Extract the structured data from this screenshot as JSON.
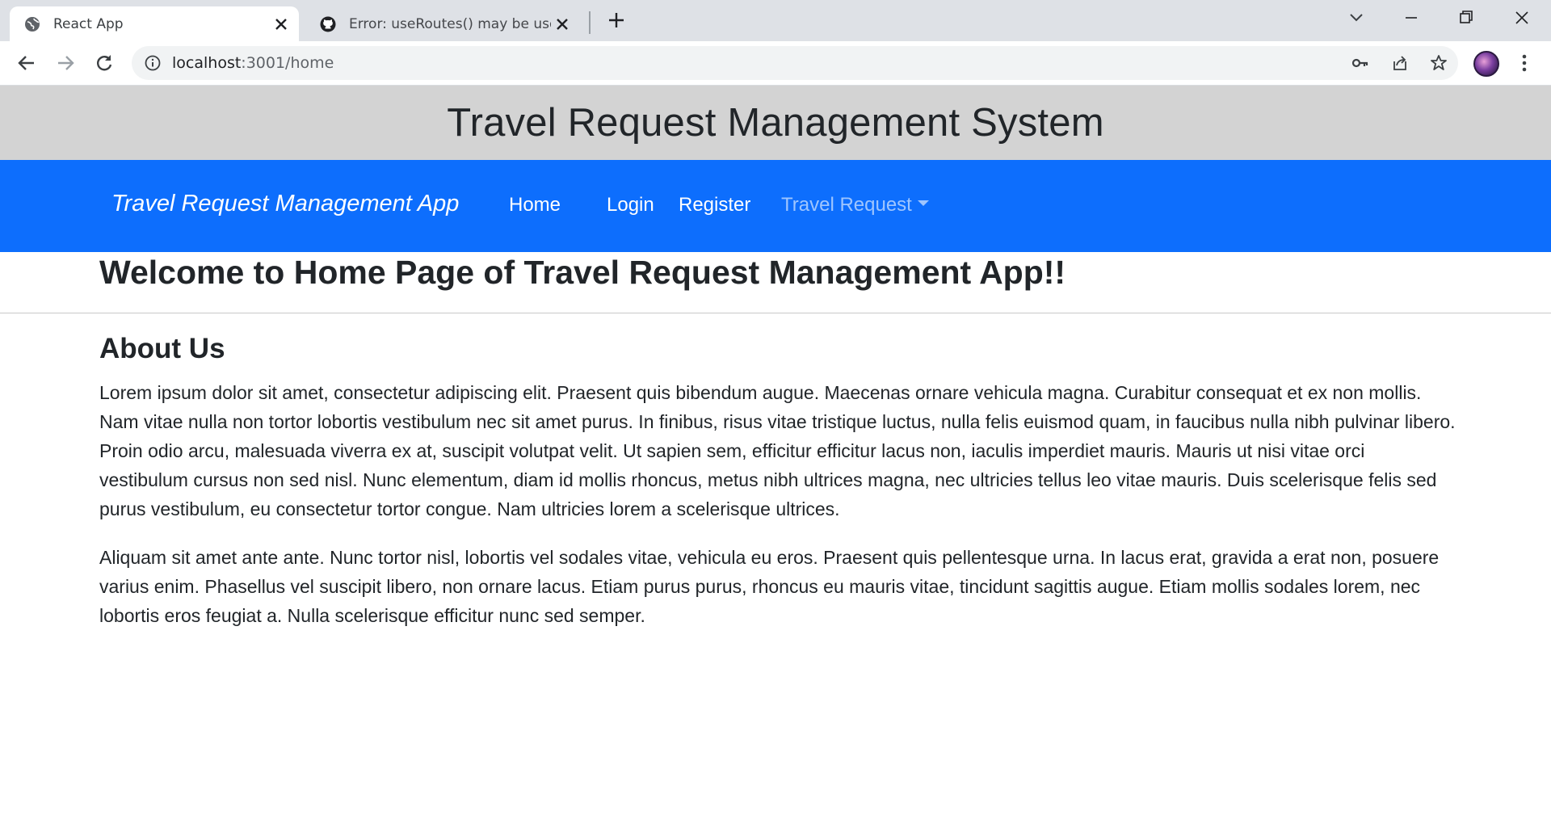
{
  "browser": {
    "tabs": [
      {
        "title": "React App",
        "icon": "globe-icon",
        "active": true
      },
      {
        "title": "Error: useRoutes() may be used only in the context",
        "icon": "github-icon",
        "active": false
      }
    ],
    "url_host": "localhost",
    "url_path": ":3001/home"
  },
  "site": {
    "header_title": "Travel Request Management System"
  },
  "navbar": {
    "brand": "Travel Request Management App",
    "links": [
      "Home",
      "Login",
      "Register"
    ],
    "dropdown": "Travel Request",
    "color": "#0d6efd"
  },
  "main": {
    "welcome": "Welcome to Home Page of Travel Request Management App!!",
    "about_title": "About Us",
    "paragraphs": [
      "Lorem ipsum dolor sit amet, consectetur adipiscing elit. Praesent quis bibendum augue. Maecenas ornare vehicula magna. Curabitur consequat et ex non mollis. Nam vitae nulla non tortor lobortis vestibulum nec sit amet purus. In finibus, risus vitae tristique luctus, nulla felis euismod quam, in faucibus nulla nibh pulvinar libero. Proin odio arcu, malesuada viverra ex at, suscipit volutpat velit. Ut sapien sem, efficitur efficitur lacus non, iaculis imperdiet mauris. Mauris ut nisi vitae orci vestibulum cursus non sed nisl. Nunc elementum, diam id mollis rhoncus, metus nibh ultrices magna, nec ultricies tellus leo vitae mauris. Duis scelerisque felis sed purus vestibulum, eu consectetur tortor congue. Nam ultricies lorem a scelerisque ultrices.",
      "Aliquam sit amet ante ante. Nunc tortor nisl, lobortis vel sodales vitae, vehicula eu eros. Praesent quis pellentesque urna. In lacus erat, gravida a erat non, posuere varius enim. Phasellus vel suscipit libero, non ornare lacus. Etiam purus purus, rhoncus eu mauris vitae, tincidunt sagittis augue. Etiam mollis sodales lorem, nec lobortis eros feugiat a. Nulla scelerisque efficitur nunc sed semper."
    ]
  }
}
